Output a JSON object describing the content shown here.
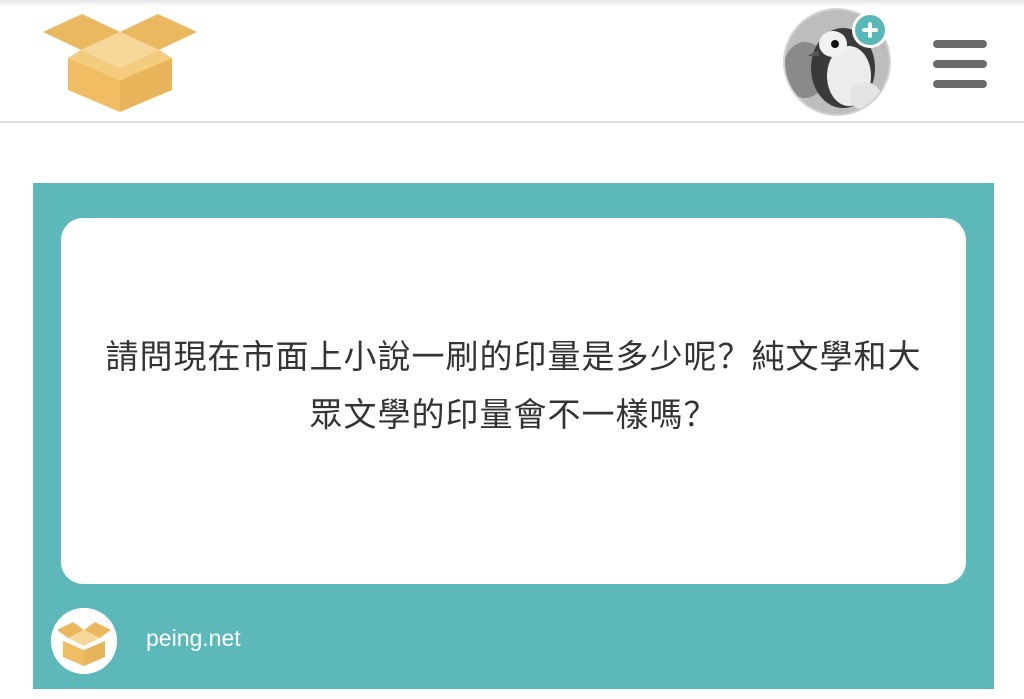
{
  "header": {
    "logo_icon": "box-icon",
    "avatar_icon": "penguin-avatar",
    "add_icon": "plus-circle-icon",
    "menu_icon": "hamburger-menu-icon"
  },
  "card": {
    "question": "請問現在市面上小說一刷的印量是多少呢？純文學和大眾文學的印量會不一樣嗎？",
    "site": "peing.net",
    "footer_icon": "box-icon"
  },
  "colors": {
    "accent": "#5db8ba",
    "box_yellow": "#f0bd62",
    "menu_gray": "#6b6b6b"
  }
}
